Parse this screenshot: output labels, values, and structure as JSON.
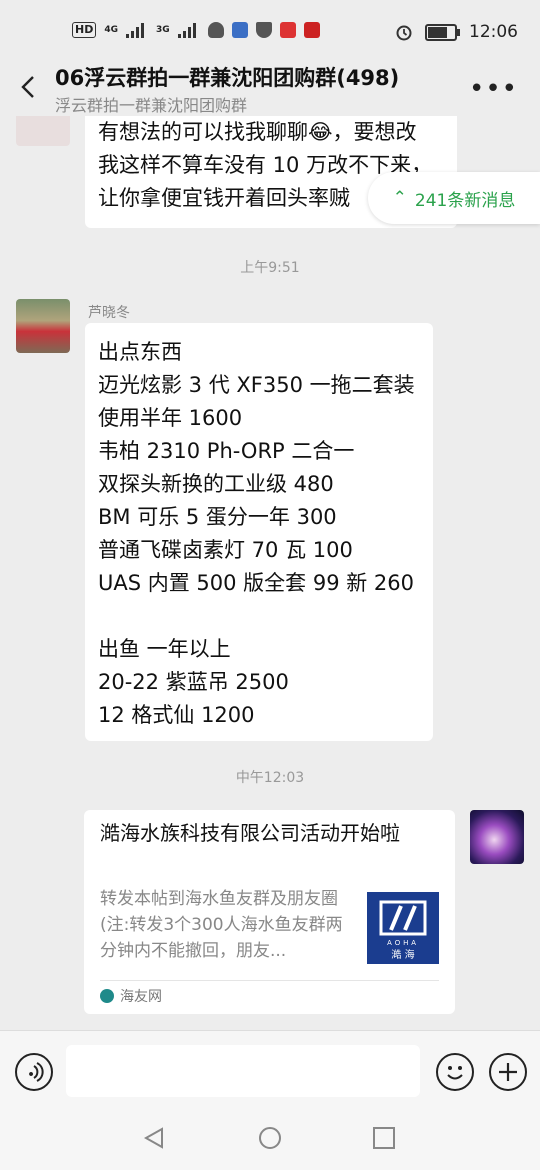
{
  "status": {
    "time": "12:06",
    "hd": "HD",
    "net1": "4G",
    "net2": "3G"
  },
  "header": {
    "title": "06浮云群拍一群兼沈阳团购群(498)",
    "subtitle": "浮云群拍一群兼沈阳团购群"
  },
  "new_messages": "241条新消息",
  "messages": {
    "first_lines": [
      "有想法的可以找我聊聊😂，要想改",
      "我这样不算车没有 10 万改不下来，",
      "让你拿便宜钱开着回头率贼"
    ],
    "time1": "上午9:51",
    "sender": "芦晓冬",
    "second_lines": [
      "出点东西",
      "迈光炫影 3 代 XF350 一拖二套装",
      "使用半年 1600",
      "韦柏 2310 Ph-ORP 二合一",
      "双探头新换的工业级 480",
      "BM 可乐 5 蛋分一年  300",
      "普通飞碟卤素灯 70 瓦 100",
      "UAS 内置 500 版全套 99 新 260",
      "",
      "出鱼 一年以上",
      "20-22 紫蓝吊 2500",
      "12 格式仙 1200"
    ],
    "time2": "中午12:03"
  },
  "card": {
    "title": "澔海水族科技有限公司活动开始啦",
    "desc": "转发本帖到海水鱼友群及朋友圈(注:转发3个300人海水鱼友群两分钟内不能撤回，朋友...",
    "thumb_text": "AOHA",
    "thumb_cn": "澔 海",
    "source": "海友网"
  },
  "colors": {
    "green": "#2ba24c",
    "bg": "#ededed"
  }
}
